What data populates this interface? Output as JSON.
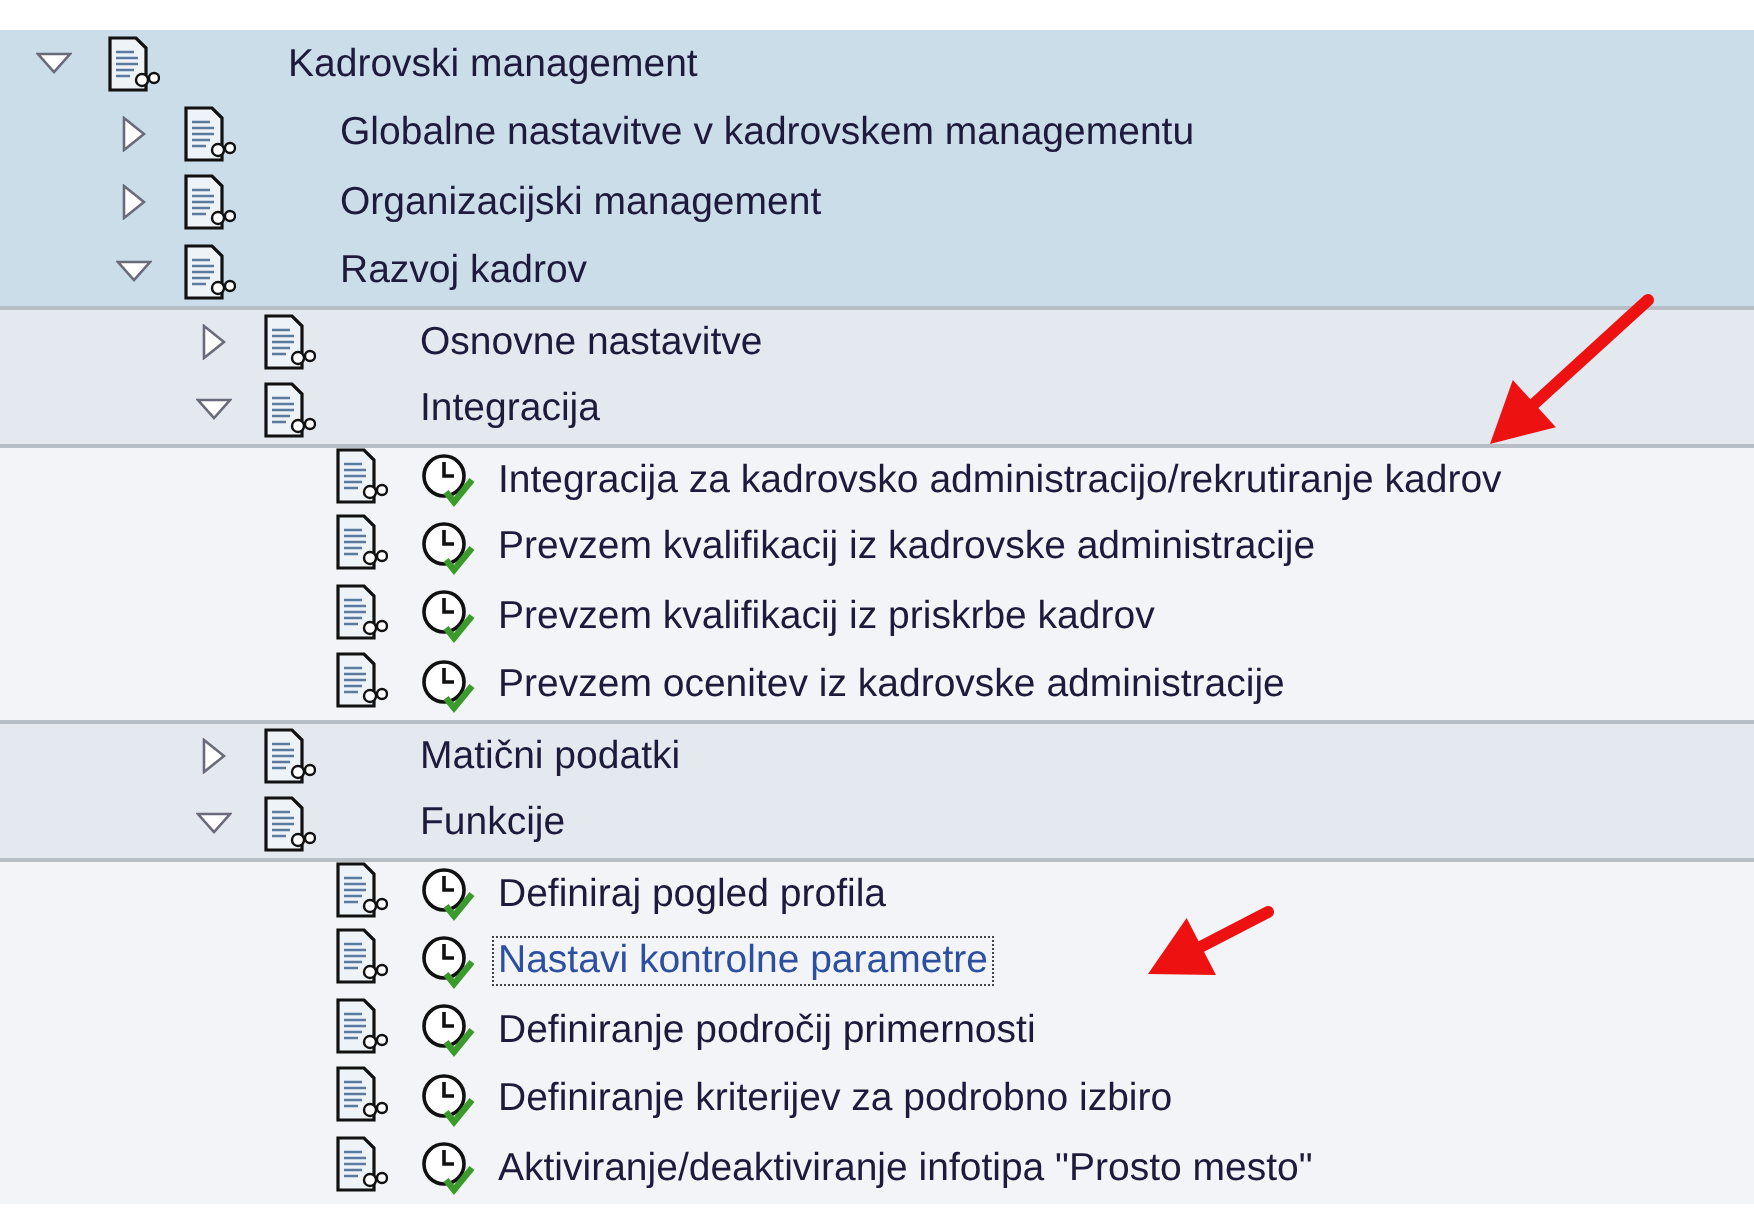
{
  "tree": [
    {
      "label": "Kadrovski management",
      "expanded": true,
      "children": [
        {
          "label": "Globalne nastavitve v kadrovskem managementu",
          "expanded": false
        },
        {
          "label": "Organizacijski management",
          "expanded": false
        },
        {
          "label": "Razvoj kadrov",
          "expanded": true,
          "children": [
            {
              "label": "Osnovne nastavitve",
              "expanded": false
            },
            {
              "label": "Integracija",
              "expanded": true,
              "children": [
                {
                  "label": "Integracija za kadrovsko administracijo/rekrutiranje kadrov",
                  "selected": false
                },
                {
                  "label": "Prevzem kvalifikacij iz kadrovske administracije",
                  "selected": false
                },
                {
                  "label": "Prevzem kvalifikacij iz priskrbe kadrov",
                  "selected": false
                },
                {
                  "label": "Prevzem ocenitev iz kadrovske administracije",
                  "selected": false
                }
              ]
            },
            {
              "label": "Matični podatki",
              "expanded": false
            },
            {
              "label": "Funkcije",
              "expanded": true,
              "children": [
                {
                  "label": "Definiraj pogled profila",
                  "selected": false
                },
                {
                  "label": "Nastavi kontrolne parametre",
                  "selected": true
                },
                {
                  "label": "Definiranje področij primernosti",
                  "selected": false
                },
                {
                  "label": "Definiranje kriterijev za podrobno izbiro",
                  "selected": false
                },
                {
                  "label": "Aktiviranje/deaktiviranje infotipa \"Prosto mesto\"",
                  "selected": false
                }
              ]
            }
          ]
        }
      ]
    }
  ]
}
